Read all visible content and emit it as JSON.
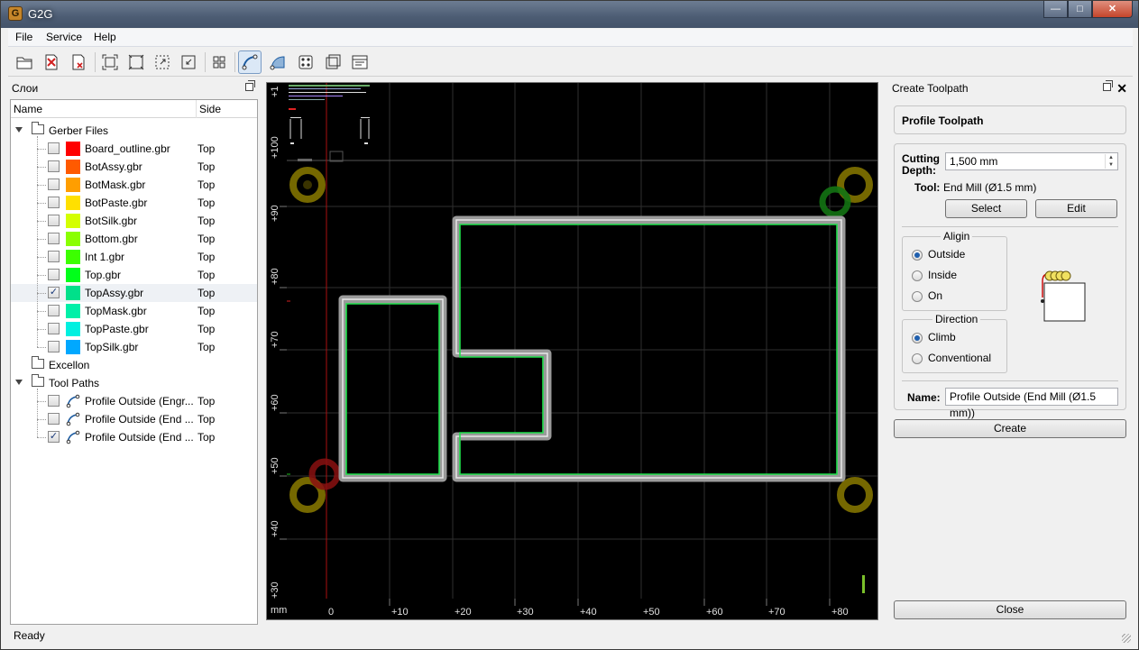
{
  "window": {
    "title": "G2G",
    "app_icon_glyph": "G"
  },
  "menu": [
    "File",
    "Service",
    "Help"
  ],
  "toolbar": {
    "icons": [
      "open-folder-icon",
      "open-pdf-icon",
      "close-all-icon",
      "zoom-fit-icon",
      "zoom-100-icon",
      "zoom-in-icon",
      "zoom-out-icon",
      "select-all-icon",
      "profile-toolpath-icon",
      "pocket-toolpath-icon",
      "drill-toolpath-icon",
      "copper-thieving-icon",
      "gcode-properties-icon"
    ],
    "active": "profile-toolpath-icon"
  },
  "layers_panel": {
    "title": "Слои",
    "col_name": "Name",
    "col_side": "Side",
    "groups": [
      {
        "label": "Gerber Files",
        "expanded": true,
        "items": [
          {
            "label": "Board_outline.gbr",
            "side": "Top",
            "color": "#ff0000",
            "checked": false
          },
          {
            "label": "BotAssy.gbr",
            "side": "Top",
            "color": "#ff5a00",
            "checked": false
          },
          {
            "label": "BotMask.gbr",
            "side": "Top",
            "color": "#ff9e00",
            "checked": false
          },
          {
            "label": "BotPaste.gbr",
            "side": "Top",
            "color": "#ffe000",
            "checked": false
          },
          {
            "label": "BotSilk.gbr",
            "side": "Top",
            "color": "#d4ff00",
            "checked": false
          },
          {
            "label": "Bottom.gbr",
            "side": "Top",
            "color": "#8aff00",
            "checked": false
          },
          {
            "label": "Int 1.gbr",
            "side": "Top",
            "color": "#3cff00",
            "checked": false
          },
          {
            "label": "Top.gbr",
            "side": "Top",
            "color": "#00ff1a",
            "checked": false
          },
          {
            "label": "TopAssy.gbr",
            "side": "Top",
            "color": "#00e08a",
            "checked": true
          },
          {
            "label": "TopMask.gbr",
            "side": "Top",
            "color": "#00f0a8",
            "checked": false
          },
          {
            "label": "TopPaste.gbr",
            "side": "Top",
            "color": "#00f0e0",
            "checked": false
          },
          {
            "label": "TopSilk.gbr",
            "side": "Top",
            "color": "#00a8ff",
            "checked": false
          }
        ]
      },
      {
        "label": "Excellon",
        "expanded": false,
        "items": []
      },
      {
        "label": "Tool Paths",
        "expanded": true,
        "items": [
          {
            "label": "Profile Outside (Engr...",
            "side": "Top",
            "checked": false
          },
          {
            "label": "Profile Outside (End ...",
            "side": "Top",
            "checked": false
          },
          {
            "label": "Profile Outside (End ...",
            "side": "Top",
            "checked": true
          }
        ]
      }
    ]
  },
  "canvas": {
    "unit": "mm",
    "x_ticks": [
      "0",
      "+10",
      "+20",
      "+30",
      "+40",
      "+50",
      "+60",
      "+70",
      "+80"
    ],
    "y_ticks": [
      "+100",
      "+90",
      "+80",
      "+70",
      "+60",
      "+50",
      "+40",
      "+30"
    ],
    "y_top_tick": "+1"
  },
  "toolpath_panel": {
    "title": "Create Toolpath",
    "header": "Profile Toolpath",
    "cutting_depth_label_1": "Cutting",
    "cutting_depth_label_2": "Depth:",
    "cutting_depth_value": "1,500 mm",
    "tool_label": "Tool:",
    "tool_value": "End Mill (Ø1.5 mm)",
    "select_button": "Select",
    "edit_button": "Edit",
    "align_title": "Aligin",
    "align_options": [
      "Outside",
      "Inside",
      "On"
    ],
    "align_selected": "Outside",
    "direction_title": "Direction",
    "direction_options": [
      "Climb",
      "Conventional"
    ],
    "direction_selected": "Climb",
    "name_label": "Name:",
    "name_value": "Profile Outside (End Mill (Ø1.5 mm))",
    "create_button": "Create",
    "close_button": "Close"
  },
  "status": {
    "text": "Ready"
  }
}
